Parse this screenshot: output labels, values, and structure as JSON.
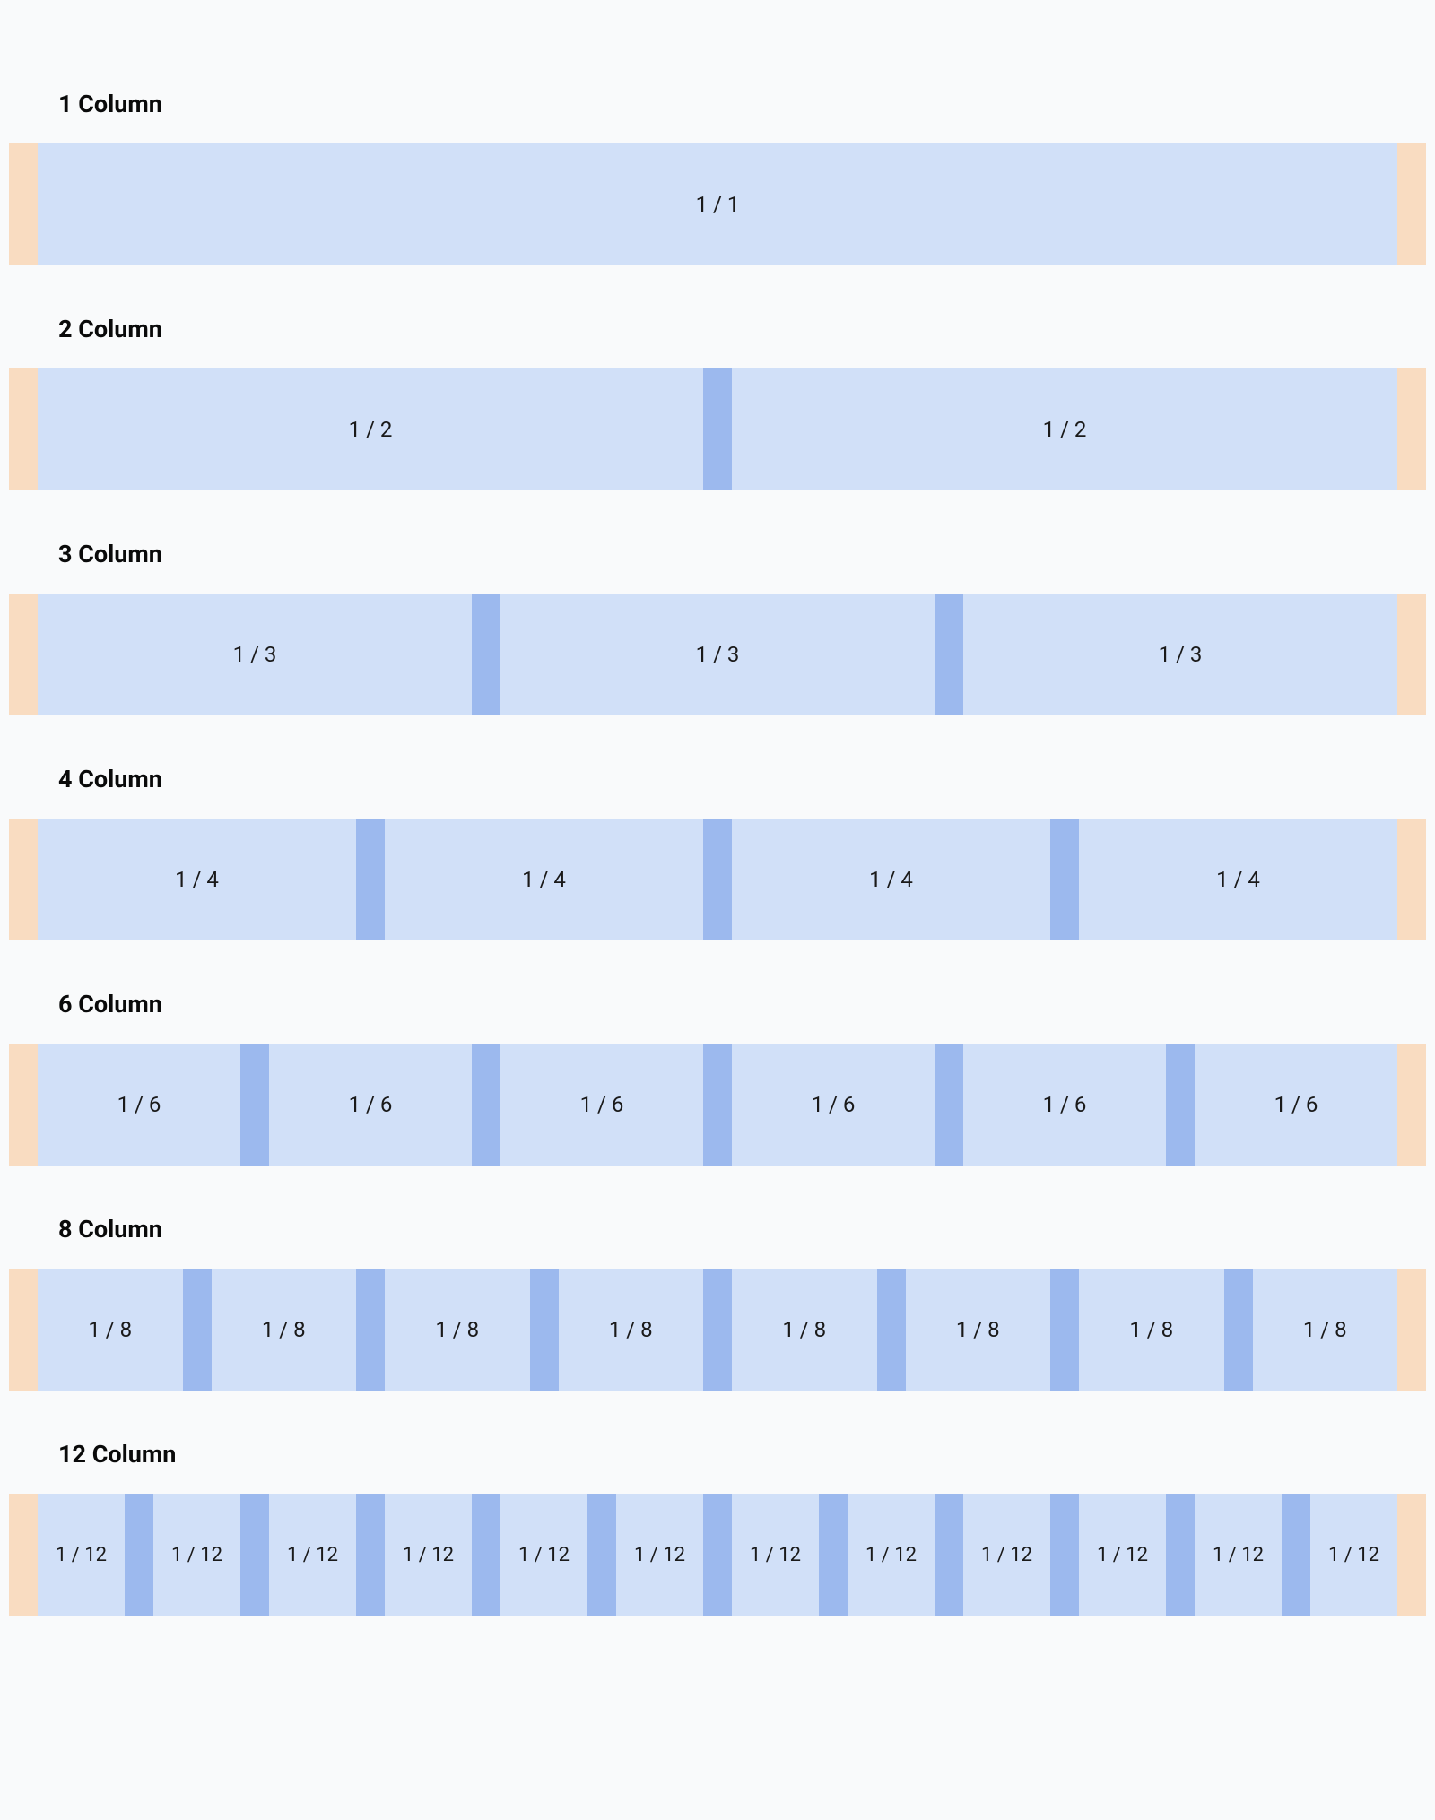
{
  "sections": [
    {
      "title": "1 Column",
      "columns": 1,
      "label": "1 / 1"
    },
    {
      "title": "2 Column",
      "columns": 2,
      "label": "1 / 2"
    },
    {
      "title": "3 Column",
      "columns": 3,
      "label": "1 / 3"
    },
    {
      "title": "4 Column",
      "columns": 4,
      "label": "1 / 4"
    },
    {
      "title": "6 Column",
      "columns": 6,
      "label": "1 / 6"
    },
    {
      "title": "8 Column",
      "columns": 8,
      "label": "1 / 8"
    },
    {
      "title": "12 Column",
      "columns": 12,
      "label": "1 / 12"
    }
  ],
  "colors": {
    "background": "#f9fafb",
    "margin": "#f9dcc1",
    "column": "#d1e0f8",
    "gutter": "#9cb9ee",
    "text": "#0a0a0a"
  }
}
